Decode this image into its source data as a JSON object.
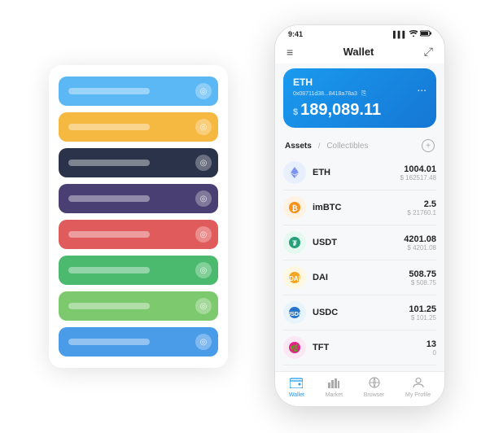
{
  "bgPhone": {
    "cards": [
      {
        "color": "#5bb8f5",
        "iconText": "◎"
      },
      {
        "color": "#f5b942",
        "iconText": "◎"
      },
      {
        "color": "#2a3349",
        "iconText": "◎"
      },
      {
        "color": "#4a3f72",
        "iconText": "◎"
      },
      {
        "color": "#e05c5c",
        "iconText": "◎"
      },
      {
        "color": "#4cba6e",
        "iconText": "◎"
      },
      {
        "color": "#7dc96e",
        "iconText": "◎"
      },
      {
        "color": "#4a9be8",
        "iconText": "◎"
      }
    ]
  },
  "statusBar": {
    "time": "9:41",
    "signal": "▌▌▌",
    "wifi": "wifi",
    "battery": "battery"
  },
  "header": {
    "menuIcon": "≡",
    "title": "Wallet",
    "expandIcon": "⤢"
  },
  "ethCard": {
    "title": "ETH",
    "address": "0x08711d38...8418a78a3",
    "copyIcon": "⎘",
    "moreIcon": "...",
    "dollarSign": "$",
    "balance": "189,089.11"
  },
  "assetsTabs": {
    "activeTab": "Assets",
    "separator": "/",
    "inactiveTab": "Collectibles",
    "addIcon": "+"
  },
  "assets": [
    {
      "name": "ETH",
      "amount": "1004.01",
      "usd": "$ 162517.48",
      "iconColor": "#627eea",
      "iconText": "♦",
      "iconType": "eth"
    },
    {
      "name": "imBTC",
      "amount": "2.5",
      "usd": "$ 21760.1",
      "iconColor": "#f7931a",
      "iconText": "₿",
      "iconType": "imbtc"
    },
    {
      "name": "USDT",
      "amount": "4201.08",
      "usd": "$ 4201.08",
      "iconColor": "#26a17b",
      "iconText": "₮",
      "iconType": "usdt"
    },
    {
      "name": "DAI",
      "amount": "508.75",
      "usd": "$ 508.75",
      "iconColor": "#f5a623",
      "iconText": "◈",
      "iconType": "dai"
    },
    {
      "name": "USDC",
      "amount": "101.25",
      "usd": "$ 101.25",
      "iconColor": "#2775ca",
      "iconText": "©",
      "iconType": "usdc"
    },
    {
      "name": "TFT",
      "amount": "13",
      "usd": "0",
      "iconColor": "#e91e8c",
      "iconText": "🌿",
      "iconType": "tft"
    }
  ],
  "bottomNav": [
    {
      "label": "Wallet",
      "icon": "◉",
      "active": true
    },
    {
      "label": "Market",
      "icon": "📊",
      "active": false
    },
    {
      "label": "Browser",
      "icon": "👤",
      "active": false
    },
    {
      "label": "My Profile",
      "icon": "👤",
      "active": false
    }
  ]
}
